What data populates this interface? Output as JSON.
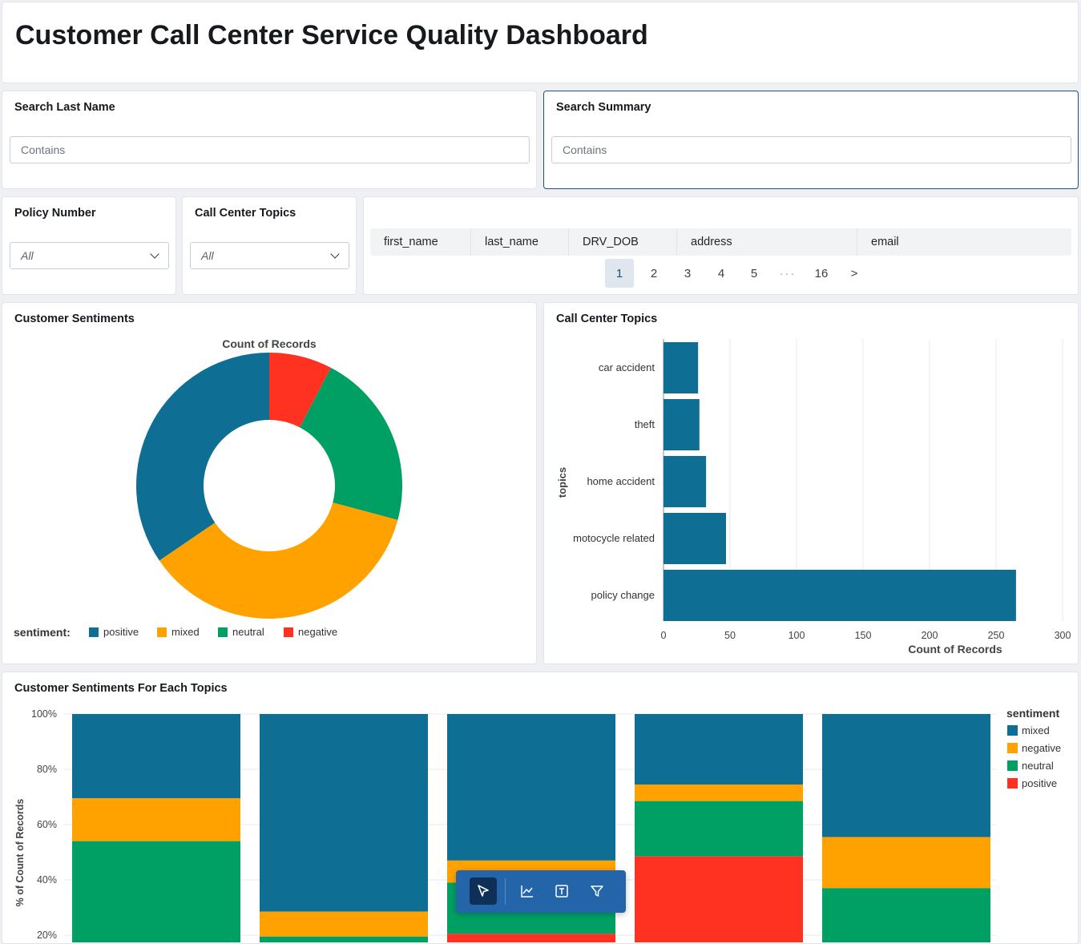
{
  "dashboard": {
    "title": "Customer Call Center Service Quality Dashboard"
  },
  "filters": {
    "last_name": {
      "label": "Search Last Name",
      "placeholder": "Contains"
    },
    "summary": {
      "label": "Search Summary",
      "placeholder": "Contains"
    },
    "policy_number": {
      "label": "Policy Number",
      "value": "All"
    },
    "topics": {
      "label": "Call Center Topics",
      "value": "All"
    }
  },
  "table": {
    "columns": [
      "first_name",
      "last_name",
      "DRV_DOB",
      "address",
      "email"
    ],
    "pagination": {
      "pages": [
        "1",
        "2",
        "3",
        "4",
        "5"
      ],
      "ellipsis": "···",
      "last": "16",
      "next": ">",
      "current": "1"
    }
  },
  "sentiment_card": {
    "title": "Customer Sentiments"
  },
  "topics_card": {
    "title": "Call Center Topics"
  },
  "stacked_card": {
    "title": "Customer Sentiments For Each Topics"
  },
  "colors": {
    "blue": "#0e6e94",
    "orange": "#ffa200",
    "green": "#00a065",
    "red": "#ff3120",
    "toolbar": "#2365a8"
  },
  "toolbar": {
    "icons": [
      "cursor-icon",
      "line-chart-icon",
      "text-icon",
      "filter-icon"
    ]
  },
  "chart_data": [
    {
      "type": "pie",
      "title": "Count of Records",
      "legend_title": "sentiment:",
      "legend_position": "bottom",
      "categories": [
        "positive",
        "mixed",
        "neutral",
        "negative"
      ],
      "values": [
        135,
        142,
        84,
        30
      ],
      "colors": [
        "#0e6e94",
        "#ffa200",
        "#00a065",
        "#ff3120"
      ]
    },
    {
      "type": "bar",
      "orientation": "horizontal",
      "categories": [
        "car accident",
        "theft",
        "home accident",
        "motocycle related",
        "policy change"
      ],
      "values": [
        26,
        27,
        32,
        47,
        265
      ],
      "xlabel": "Count of Records",
      "ylabel": "topics",
      "xlim": [
        0,
        300
      ],
      "xticks": [
        0,
        50,
        100,
        150,
        200,
        250,
        300
      ],
      "grid": true,
      "color": "#0e6e94"
    },
    {
      "type": "bar",
      "stacked": true,
      "normalized": true,
      "ylabel": "% of Count of Records",
      "yticks": [
        "20%",
        "40%",
        "60%",
        "80%",
        "100%"
      ],
      "ylim_visible": [
        20,
        100
      ],
      "legend_title": "sentiment",
      "legend_position": "right",
      "series": [
        {
          "name": "mixed",
          "color": "#0e6e94",
          "values": [
            30.5,
            71.5,
            53,
            25.5,
            44.5
          ]
        },
        {
          "name": "negative",
          "color": "#ffa200",
          "values": [
            15.5,
            9,
            8,
            6,
            18.5
          ]
        },
        {
          "name": "neutral",
          "color": "#00a065",
          "values": [
            54,
            19.5,
            18.5,
            20,
            37
          ]
        },
        {
          "name": "positive",
          "color": "#ff3120",
          "values": [
            0,
            0,
            20.5,
            48.5,
            0
          ]
        }
      ]
    }
  ]
}
